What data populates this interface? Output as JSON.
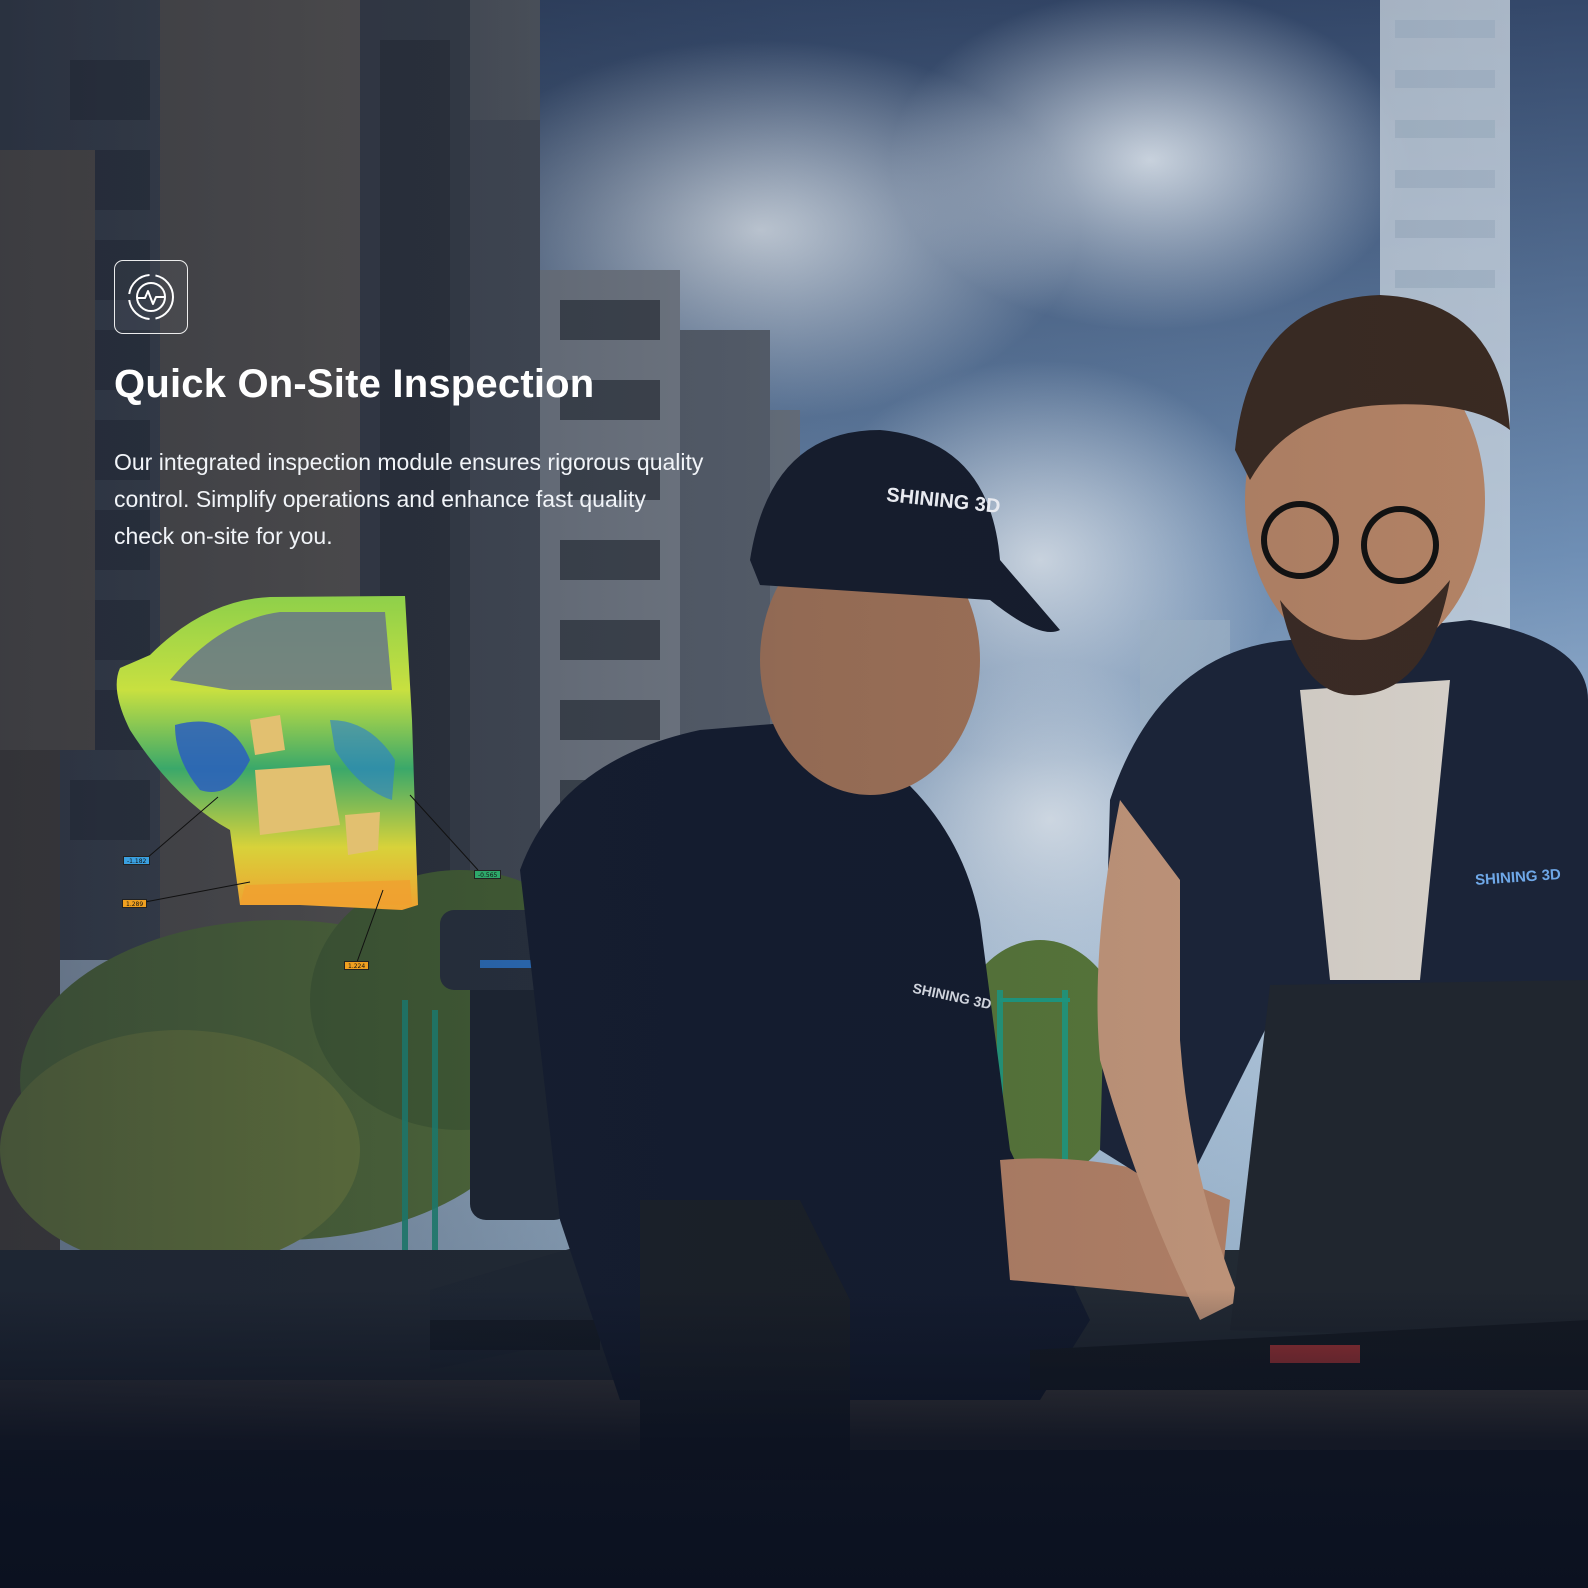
{
  "section": {
    "icon": "inspection-target-icon",
    "title": "Quick On-Site Inspection",
    "description": "Our integrated inspection module ensures rigorous quality control. Simplify operations and enhance fast quality check on-site for you."
  },
  "inspection_graphic": {
    "deviation_labels": [
      {
        "value": "-1.182",
        "color": "#3aa0e0"
      },
      {
        "value": "-0.565",
        "color": "#2ea86a"
      },
      {
        "value": "1.289",
        "color": "#f0a020"
      },
      {
        "value": "1.224",
        "color": "#f0a020"
      }
    ]
  },
  "photo": {
    "cap_logo_text": "SHINING 3D",
    "shirt_logo_text": "SHINING 3D",
    "vest_logo_text": "SHINING 3D"
  }
}
